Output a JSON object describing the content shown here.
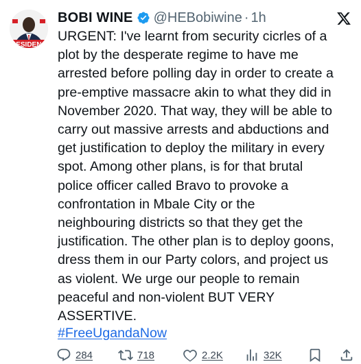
{
  "author": {
    "name": "BOBI WINE",
    "handle": "@HEBobiwine",
    "separator": "·",
    "time": "1h",
    "avatar_banner_text": "RESIDEN"
  },
  "tweet": {
    "text": "URGENT: I've learnt from security cicrles of a\nplot by the desperate regime to have me\narrested before polling day in order to create a\npre-emptive massacre akin to what they did in\nNovember 2020. That way, they will be able to\ncarry out massive arrests and abductions and\nget justification to deploy the military in every\nspot. Among other plans, is for that brutal\npolice officer called Bravo to provoke a\nconfrontation in Mbale City or the\nneighbouring districts so that they get the\njustification. The other plan is to deploy goons,\ndress them in our Party colors, and project us\nas violent. We urge our people to remain\npeaceful and non-violent BUT VERY\nASSERTIVE.",
    "hashtag": "#FreeUgandaNow"
  },
  "actions": {
    "replies": "284",
    "reposts": "718",
    "likes": "2.2K",
    "views": "32K"
  },
  "colors": {
    "link": "#1d6ae5",
    "muted": "#536471",
    "verified": "#1d9bf0",
    "party_red": "#d62027"
  },
  "icons": [
    "verified-badge-icon",
    "x-logo-icon",
    "reply-icon",
    "repost-icon",
    "like-icon",
    "views-icon",
    "bookmark-icon",
    "share-icon"
  ]
}
